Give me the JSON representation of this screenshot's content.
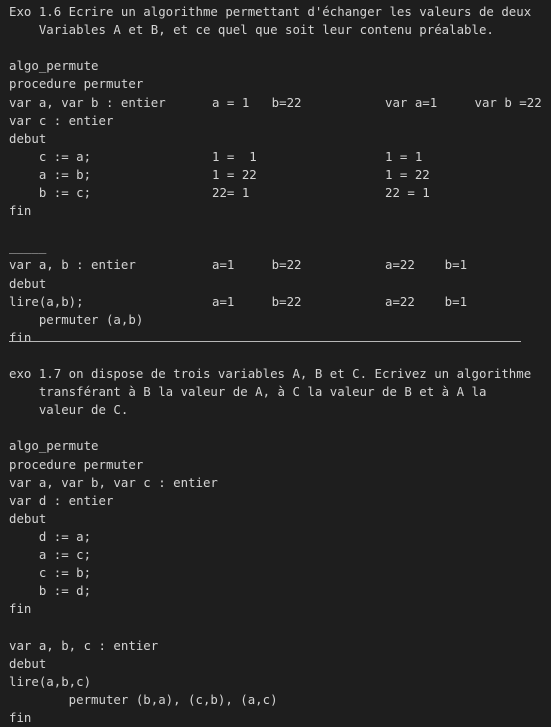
{
  "editor": {
    "lines": [
      {
        "c": [
          {
            "t": "Exo 1.6 Ecrire un algorithme permettant d'échanger les valeurs de deux"
          }
        ]
      },
      {
        "c": [
          {
            "t": "    Variables A et B, et ce quel que soit leur contenu préalable."
          }
        ]
      },
      {
        "c": []
      },
      {
        "c": [
          {
            "t": "algo_permute"
          }
        ]
      },
      {
        "c": [
          {
            "t": "procedure permuter"
          }
        ]
      },
      {
        "c": [
          {
            "t": "var a, var b : entier"
          },
          {
            "t": "a = 1   b=22"
          },
          {
            "t": "var a=1     var b =22"
          }
        ]
      },
      {
        "c": [
          {
            "t": "var c : entier"
          }
        ]
      },
      {
        "c": [
          {
            "t": "debut"
          }
        ]
      },
      {
        "c": [
          {
            "t": "    c := a;"
          },
          {
            "t": "1 =  1"
          },
          {
            "t": "1 = 1"
          }
        ]
      },
      {
        "c": [
          {
            "t": "    a := b;"
          },
          {
            "t": "1 = 22"
          },
          {
            "t": "1 = 22"
          }
        ]
      },
      {
        "c": [
          {
            "t": "    b := c;"
          },
          {
            "t": "22= 1"
          },
          {
            "t": "22 = 1"
          }
        ]
      },
      {
        "c": [
          {
            "t": "fin"
          }
        ]
      },
      {
        "c": []
      },
      {
        "c": [
          {
            "t": "_____"
          }
        ]
      },
      {
        "c": [
          {
            "t": "var a, b : entier"
          },
          {
            "t": "a=1     b=22"
          },
          {
            "t": "a=22    b=1"
          }
        ]
      },
      {
        "c": [
          {
            "t": "debut"
          }
        ]
      },
      {
        "c": [
          {
            "t": "lire(a,b);"
          },
          {
            "t": "a=1     b=22"
          },
          {
            "t": "a=22    b=1"
          }
        ]
      },
      {
        "c": [
          {
            "t": "    permuter (a,b)"
          }
        ]
      },
      {
        "c": [
          {
            "t": "fin"
          }
        ]
      },
      {
        "c": []
      },
      {
        "c": [
          {
            "t": "exo 1.7 on dispose de trois variables A, B et C. Ecrivez un algorithme"
          }
        ]
      },
      {
        "c": [
          {
            "t": "    transférant à B la valeur de A, à C la valeur de B et à A la"
          }
        ]
      },
      {
        "c": [
          {
            "t": "    valeur de C."
          }
        ]
      },
      {
        "c": []
      },
      {
        "c": [
          {
            "t": "algo_permute"
          }
        ]
      },
      {
        "c": [
          {
            "t": "procedure permuter"
          }
        ]
      },
      {
        "c": [
          {
            "t": "var a, var b, var c : entier"
          }
        ]
      },
      {
        "c": [
          {
            "t": "var d : entier"
          }
        ]
      },
      {
        "c": [
          {
            "t": "debut"
          }
        ]
      },
      {
        "c": [
          {
            "t": "    d := a;"
          }
        ]
      },
      {
        "c": [
          {
            "t": "    a := c;"
          }
        ]
      },
      {
        "c": [
          {
            "t": "    c := b;"
          }
        ]
      },
      {
        "c": [
          {
            "t": "    b := d;"
          }
        ]
      },
      {
        "c": [
          {
            "t": "fin"
          }
        ]
      },
      {
        "c": []
      },
      {
        "c": [
          {
            "t": "var a, b, c : entier"
          }
        ]
      },
      {
        "c": [
          {
            "t": "debut"
          }
        ]
      },
      {
        "c": [
          {
            "t": "lire(a,b,c)"
          }
        ]
      },
      {
        "c": [
          {
            "t": "        permuter (b,a), (c,b), (a,c)"
          }
        ]
      },
      {
        "c": [
          {
            "t": "fin"
          }
        ]
      }
    ]
  }
}
